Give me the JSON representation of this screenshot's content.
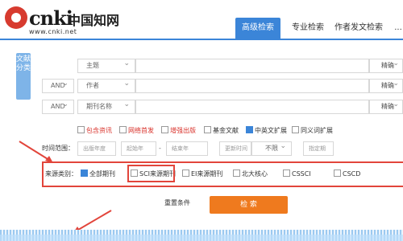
{
  "header": {
    "logo_main": "cnki",
    "logo_cn": "中国知网",
    "logo_url": "www.cnki.net",
    "tabs": [
      "高级检索",
      "专业检索",
      "作者发文检索",
      "..."
    ]
  },
  "side_tab": "文献分类",
  "rows": [
    {
      "logic": "",
      "field": "主题",
      "match": "精确"
    },
    {
      "logic": "AND",
      "field": "作者",
      "match": "精确"
    },
    {
      "logic": "AND",
      "field": "期刊名称",
      "match": "精确"
    }
  ],
  "options": [
    {
      "label": "包含资讯",
      "checked": false,
      "color": "#d9322b"
    },
    {
      "label": "网络首发",
      "checked": false,
      "color": "#d9322b"
    },
    {
      "label": "增强出版",
      "checked": false,
      "color": "#d9322b"
    },
    {
      "label": "基金文献",
      "checked": false,
      "color": "#333333"
    },
    {
      "label": "中英文扩展",
      "checked": true,
      "color": "#333333"
    },
    {
      "label": "同义词扩展",
      "checked": false,
      "color": "#333333"
    }
  ],
  "time": {
    "label": "时间范围：",
    "pub_year": "出版年度",
    "start_year": "起始年",
    "dash": "-",
    "end_year": "结束年",
    "update_time": "更新时间",
    "unlimited": "不限",
    "specify": "指定期"
  },
  "source": {
    "label": "来源类别：",
    "items": [
      {
        "label": "全部期刊",
        "checked": true
      },
      {
        "label": "SCI来源期刊",
        "checked": false
      },
      {
        "label": "EI来源期刊",
        "checked": false
      },
      {
        "label": "北大核心",
        "checked": false
      },
      {
        "label": "CSSCI",
        "checked": false
      },
      {
        "label": "CSCD",
        "checked": false
      }
    ]
  },
  "buttons": {
    "reset": "重置条件",
    "search": "检 索"
  },
  "colors": {
    "accent": "#3b85d8",
    "highlight_red": "#e2453b",
    "search_orange": "#ef7a1e"
  }
}
